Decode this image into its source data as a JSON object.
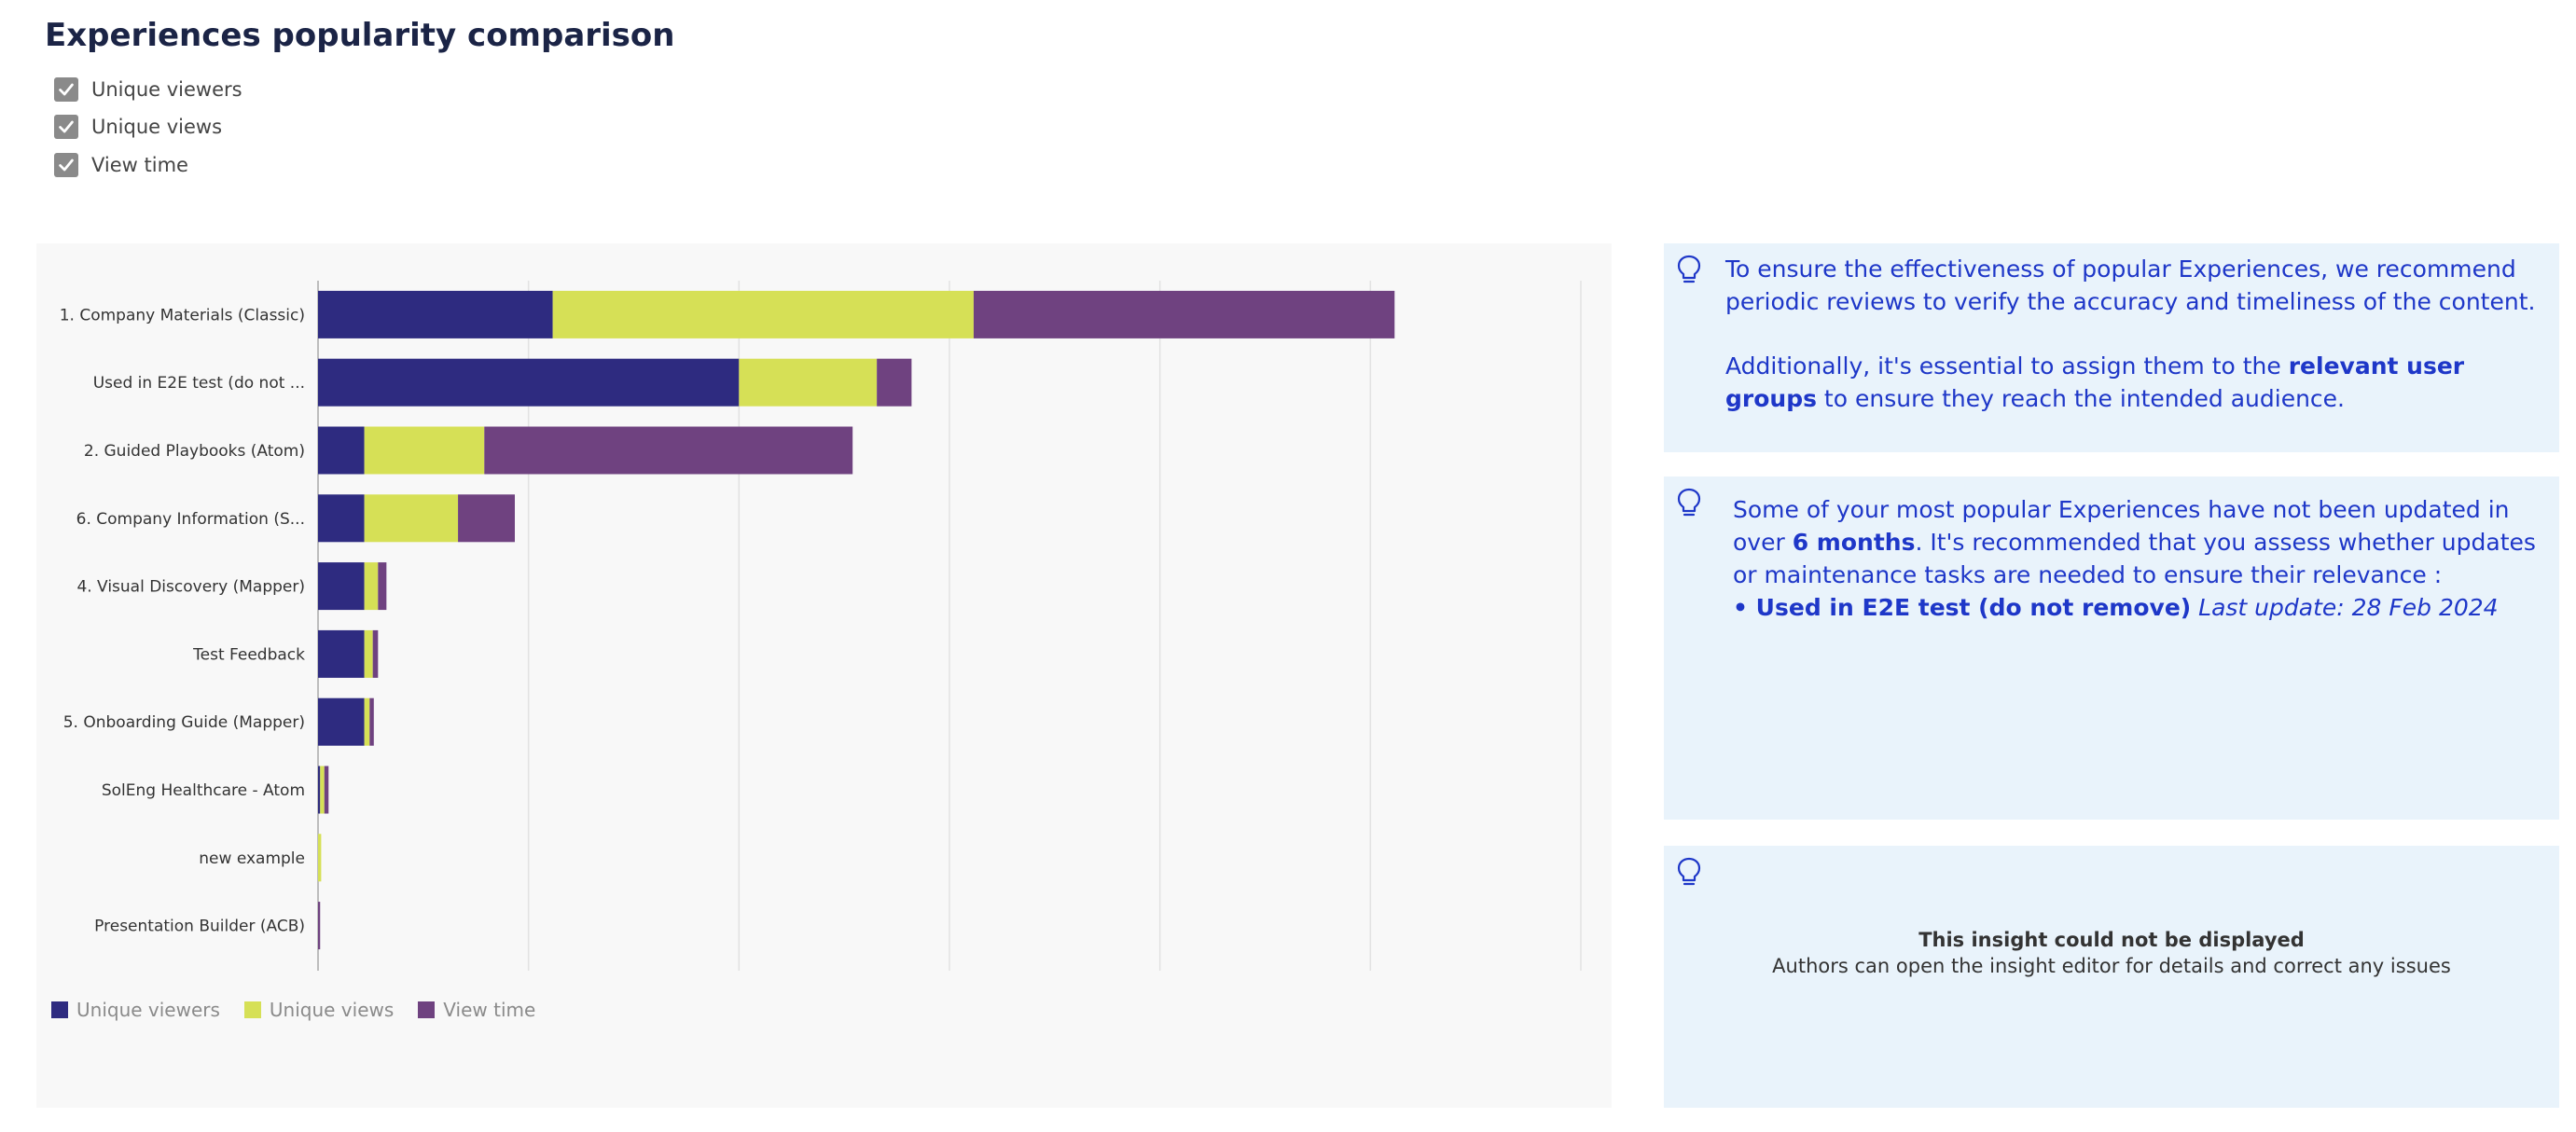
{
  "page": {
    "title": "Experiences popularity comparison"
  },
  "toggles": [
    {
      "label": "Unique viewers",
      "checked": true
    },
    {
      "label": "Unique views",
      "checked": true
    },
    {
      "label": "View time",
      "checked": true
    }
  ],
  "chart_data": {
    "type": "bar",
    "orientation": "horizontal",
    "stacked": true,
    "categories": [
      "1. Company Materials (Classic)",
      "Used in E2E test (do not ...",
      "2. Guided Playbooks (Atom)",
      "6. Company Information (S...",
      "4. Visual Discovery (Mapper)",
      "Test Feedback",
      "5. Onboarding Guide (Mapper)",
      "SolEng Healthcare - Atom",
      "new example",
      "Presentation Builder (ACB)"
    ],
    "series": [
      {
        "name": "Unique viewers",
        "color": "#2e2b80",
        "values": [
          22.3,
          40.0,
          4.4,
          4.4,
          4.4,
          4.4,
          4.4,
          0.2,
          0.0,
          0.0
        ]
      },
      {
        "name": "Unique views",
        "color": "#d6e056",
        "values": [
          40.0,
          13.1,
          11.4,
          8.9,
          1.3,
          0.8,
          0.5,
          0.4,
          0.3,
          0.0
        ]
      },
      {
        "name": "View time",
        "color": "#6f4280",
        "values": [
          40.0,
          3.3,
          35.0,
          5.4,
          0.8,
          0.5,
          0.4,
          0.4,
          0.0,
          0.2
        ]
      }
    ],
    "xlim": [
      0,
      120
    ],
    "gridline_count": 6,
    "x_tick_labels_shown": false,
    "grid": true,
    "legend_position": "bottom-left"
  },
  "insights": [
    {
      "segments": [
        {
          "text": "To ensure the effectiveness of popular Experiences, we recommend periodic reviews to verify the accuracy and timeliness of the content.",
          "bold": false,
          "italic": false
        }
      ],
      "segments2": [
        {
          "text": "Additionally, it's essential to assign them to the ",
          "bold": false,
          "italic": false
        },
        {
          "text": "relevant user groups",
          "bold": true,
          "italic": false
        },
        {
          "text": " to ensure they reach the intended audience.",
          "bold": false,
          "italic": false
        }
      ]
    },
    {
      "segments": [
        {
          "text": "Some of your most popular Experiences have not been updated in over ",
          "bold": false,
          "italic": false
        },
        {
          "text": "6 months",
          "bold": true,
          "italic": false
        },
        {
          "text": ". It's recommended that you assess whether updates or maintenance tasks are needed to ensure their relevance :",
          "bold": false,
          "italic": false
        }
      ],
      "segments2": [
        {
          "text": "• Used in E2E test (do not remove)",
          "bold": true,
          "italic": false
        },
        {
          "text": " ",
          "bold": false,
          "italic": false
        },
        {
          "text": "Last update: 28 Feb 2024",
          "bold": false,
          "italic": true
        }
      ]
    }
  ],
  "error_insight": {
    "title": "This insight could not be displayed",
    "body": "Authors can open the insight editor for details and correct any issues"
  },
  "icons": {
    "checkbox": "checkbox-checked-icon",
    "insight": "lightbulb-icon"
  },
  "colors": {
    "insight_text": "#1e37c8",
    "insight_bg": "#e9f3fb",
    "chart_bg": "#f8f8f8"
  }
}
